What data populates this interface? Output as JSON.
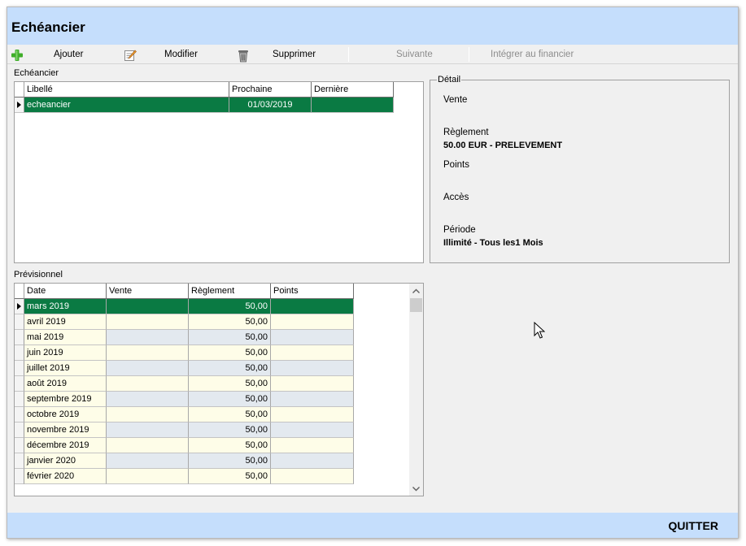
{
  "window": {
    "title": "Echéancier"
  },
  "toolbar": {
    "add_label": "Ajouter",
    "edit_label": "Modifier",
    "delete_label": "Supprimer",
    "next_label": "Suivante",
    "integrate_label": "Intégrer au financier",
    "icons": {
      "add": "plus-icon",
      "edit": "edit-notepad-icon",
      "delete": "trash-icon"
    },
    "add_icon_color": "#3fae2a"
  },
  "schedule": {
    "label": "Echéancier",
    "columns": [
      "Libellé",
      "Prochaine",
      "Dernière"
    ],
    "rows": [
      {
        "libelle": "echeancier",
        "prochaine": "01/03/2019",
        "derniere": ""
      }
    ]
  },
  "detail": {
    "legend": "Détail",
    "vente_label": "Vente",
    "vente_value": "",
    "reglement_label": "Règlement",
    "reglement_value": "50.00 EUR - PRELEVEMENT",
    "points_label": "Points",
    "points_value": "",
    "acces_label": "Accès",
    "acces_value": "",
    "periode_label": "Période",
    "periode_value": "Illimité - Tous les1 Mois"
  },
  "forecast": {
    "label": "Prévisionnel",
    "columns": [
      "Date",
      "Vente",
      "Règlement",
      "Points"
    ],
    "rows": [
      {
        "date": "mars 2019",
        "vente": "",
        "reglement": "50,00",
        "points": ""
      },
      {
        "date": "avril 2019",
        "vente": "",
        "reglement": "50,00",
        "points": ""
      },
      {
        "date": "mai 2019",
        "vente": "",
        "reglement": "50,00",
        "points": ""
      },
      {
        "date": "juin 2019",
        "vente": "",
        "reglement": "50,00",
        "points": ""
      },
      {
        "date": "juillet 2019",
        "vente": "",
        "reglement": "50,00",
        "points": ""
      },
      {
        "date": "août 2019",
        "vente": "",
        "reglement": "50,00",
        "points": ""
      },
      {
        "date": "septembre 2019",
        "vente": "",
        "reglement": "50,00",
        "points": ""
      },
      {
        "date": "octobre 2019",
        "vente": "",
        "reglement": "50,00",
        "points": ""
      },
      {
        "date": "novembre 2019",
        "vente": "",
        "reglement": "50,00",
        "points": ""
      },
      {
        "date": "décembre 2019",
        "vente": "",
        "reglement": "50,00",
        "points": ""
      },
      {
        "date": "janvier 2020",
        "vente": "",
        "reglement": "50,00",
        "points": ""
      },
      {
        "date": "février 2020",
        "vente": "",
        "reglement": "50,00",
        "points": ""
      }
    ]
  },
  "footer": {
    "quit_label": "QUITTER"
  },
  "colors": {
    "title_bar": "#c5defc",
    "selection": "#0a7a43",
    "row_blue": "#e3e9ef",
    "row_cream": "#fefde8"
  }
}
